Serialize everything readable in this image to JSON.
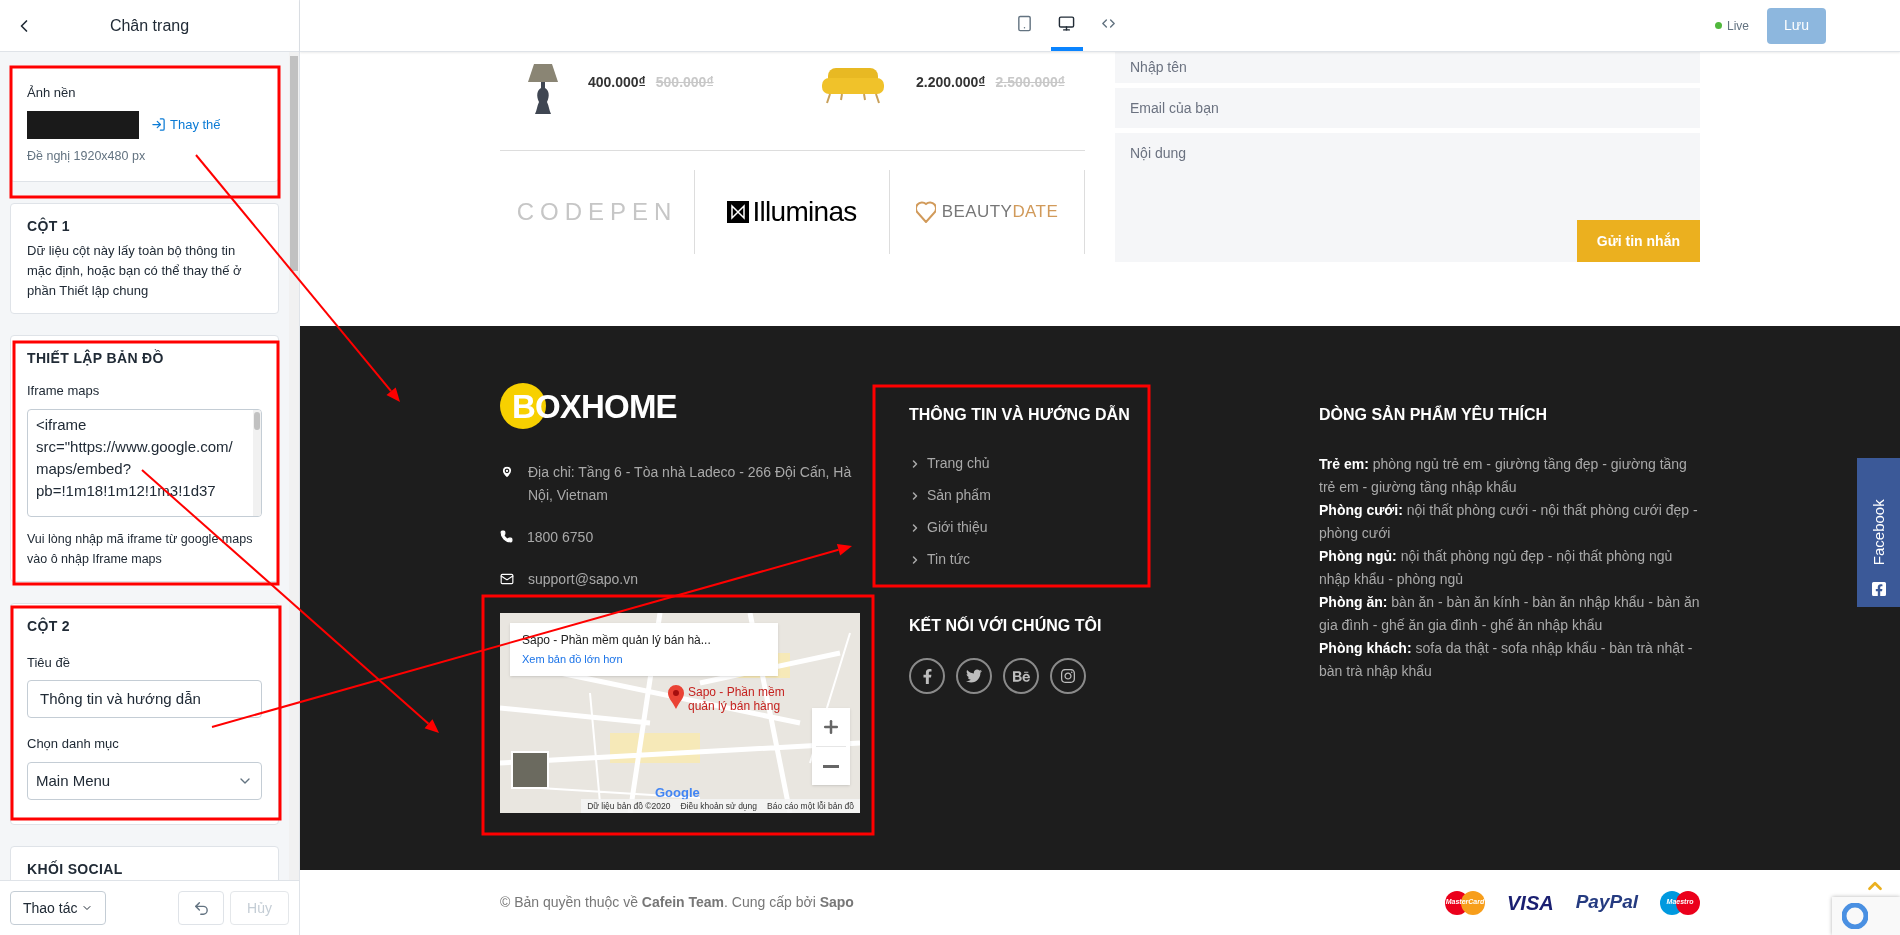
{
  "sidebar": {
    "title": "Chân trang",
    "sections": [
      {
        "kind": "image",
        "label": "Ảnh nền",
        "action": "Thay thế",
        "hint": "Đề nghị 1920x480 px"
      },
      {
        "kind": "note",
        "title": "CỘT 1",
        "text": "Dữ liệu cột này lấy toàn bộ thông tin mặc định, hoặc bạn có thể thay thế ở phần Thiết lập chung"
      },
      {
        "kind": "textarea",
        "title": "THIẾT LẬP BẢN ĐỒ",
        "label": "Iframe maps",
        "value": "<iframe src=\"https://www.google.com/maps/embed?pb=!1m18!1m12!1m3!1d37",
        "hint": "Vui lòng nhập mã iframe từ google maps vào ô nhập Iframe maps"
      },
      {
        "kind": "fields",
        "title": "CỘT 2",
        "fields": [
          {
            "kind": "text",
            "label": "Tiêu đề",
            "value": "Thông tin và hướng dẫn"
          },
          {
            "kind": "select",
            "label": "Chọn danh mục",
            "value": "Main Menu"
          }
        ]
      },
      {
        "kind": "note",
        "title": "KHỐI SOCIAL"
      }
    ],
    "actions": {
      "menu": "Thao tác",
      "undo_disabled": false,
      "cancel": "Hủy",
      "cancel_disabled": true
    }
  },
  "toolbar": {
    "devices": [
      {
        "kind": "tablet",
        "selected": false
      },
      {
        "kind": "desktop",
        "selected": true
      },
      {
        "kind": "fullwidth",
        "selected": false
      }
    ],
    "status": {
      "label": "Live",
      "live": true
    },
    "save": {
      "label": "Lưu",
      "disabled": true
    }
  },
  "preview": {
    "products": [
      {
        "kind": "lamp",
        "price": "400.000₫",
        "old_price": "500.000₫"
      },
      {
        "kind": "sofa",
        "price": "2.200.000₫",
        "old_price": "2.500.000₫"
      }
    ],
    "brands": [
      {
        "kind": "cube",
        "name": "CODEPEN"
      },
      {
        "kind": "bowtie",
        "name": "Illuminas"
      },
      {
        "kind": "pin",
        "name": "BEAUTY",
        "accent": "DATE"
      }
    ],
    "contact_form": {
      "name_placeholder": "Nhập tên",
      "email_placeholder": "Email của bạn",
      "message_placeholder": "Nội dung",
      "submit": "Gửi tin nhắn"
    },
    "footer": {
      "logo": "BOXHOME",
      "contacts": [
        {
          "kind": "address",
          "text": "Địa chỉ: Tầng 6 - Tòa nhà Ladeco - 266 Đội Cấn, Hà Nội, Vietnam"
        },
        {
          "kind": "phone",
          "text": "1800 6750"
        },
        {
          "kind": "email",
          "text": "support@sapo.vn"
        }
      ],
      "map": {
        "card_title": "Sapo - Phần mềm quản lý bán hà...",
        "card_link": "Xem bản đồ lớn hơn",
        "pin_label": "Sapo - Phần mềm quản lý bán hàng",
        "logo": "Google",
        "attribution": [
          "Dữ liệu bản đồ ©2020",
          "Điều khoản sử dụng",
          "Báo cáo một lỗi bản đồ"
        ]
      },
      "menu": {
        "title": "THÔNG TIN VÀ HƯỚNG DẪN",
        "links": [
          "Trang chủ",
          "Sản phẩm",
          "Giới thiệu",
          "Tin tức"
        ]
      },
      "social": {
        "title": "KẾT NỐI VỚI CHÚNG TÔI",
        "icons": [
          {
            "kind": "facebook"
          },
          {
            "kind": "twitter"
          },
          {
            "kind": "behance"
          },
          {
            "kind": "instagram"
          }
        ]
      },
      "products": {
        "title": "DÒNG SẢN PHẨM YÊU THÍCH",
        "groups": [
          "**Trẻ em:** phòng ngủ trẻ em - giường tầng đẹp - giường tầng trẻ em - giường tầng nhập khẩu",
          "**Phòng cưới:** nội thất phòng cưới - nội thất phòng cưới đẹp - phòng cưới",
          "**Phòng ngủ:** nội thất phòng ngủ đẹp - nội thất phòng ngủ nhập khẩu - phòng ngủ",
          "**Phòng ăn:** bàn ăn - bàn ăn kính - bàn ăn nhập khẩu - bàn ăn gia đình - ghế ăn gia đình - ghế ăn nhập khẩu",
          "**Phòng khách:** sofa da thật - sofa nhập khẩu - bàn trà nhật - bàn trà nhập khẩu"
        ]
      }
    },
    "copyright": "© Bản quyền thuộc về **Cafein Team**. Cung cấp bởi **Sapo**",
    "payments": [
      {
        "kind": "mastercard",
        "name": "MasterCard"
      },
      {
        "kind": "visa",
        "name": "VISA"
      },
      {
        "kind": "paypal",
        "name": "PayPal"
      },
      {
        "kind": "maestro",
        "name": "Maestro"
      }
    ],
    "side_tab": "Facebook"
  }
}
